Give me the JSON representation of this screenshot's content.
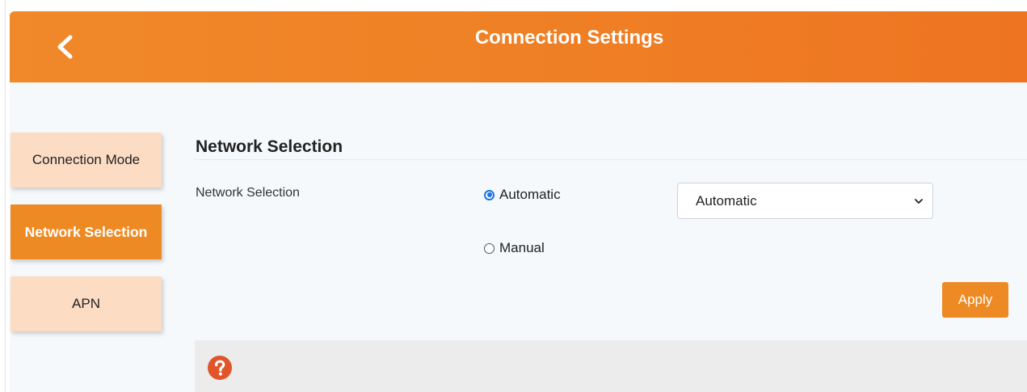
{
  "header": {
    "title": "Connection Settings",
    "back_icon": "chevron-left-icon"
  },
  "sidebar": {
    "items": [
      {
        "label": "Connection Mode",
        "active": false
      },
      {
        "label": "Network Selection",
        "active": true
      },
      {
        "label": "APN",
        "active": false
      }
    ]
  },
  "main": {
    "section_title": "Network Selection",
    "field_label": "Network Selection",
    "radio_options": [
      {
        "label": "Automatic",
        "checked": true
      },
      {
        "label": "Manual",
        "checked": false
      }
    ],
    "select": {
      "value": "Automatic",
      "icon": "chevron-down-icon"
    },
    "apply_label": "Apply",
    "help_icon": "question-circle-icon"
  },
  "colors": {
    "accent": "#EE8A23",
    "header_gradient_start": "#F0892A",
    "header_gradient_end": "#EE7422",
    "nav_inactive": "#FCDCC3",
    "radio_checked": "#1A73E8",
    "help_icon": "#E0562A"
  }
}
